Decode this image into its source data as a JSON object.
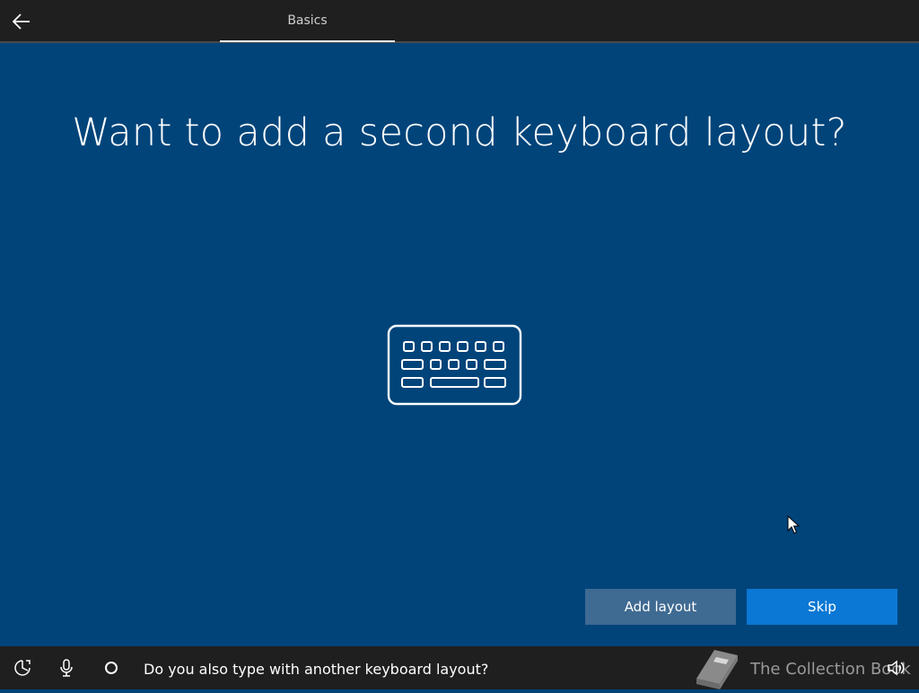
{
  "header": {
    "back_icon": "arrow-left-icon",
    "tab_label": "Basics"
  },
  "main": {
    "title": "Want to add a second keyboard layout?",
    "illustration_icon": "keyboard-icon"
  },
  "actions": {
    "add_layout_label": "Add layout",
    "skip_label": "Skip"
  },
  "footer": {
    "icons": [
      "accessibility-icon",
      "microphone-icon",
      "cortana-icon",
      "volume-icon"
    ],
    "caption": "Do you also type with another keyboard layout?",
    "watermark_text": "The Collection Book"
  },
  "colors": {
    "background": "#00447a",
    "bar": "#1f1f1f",
    "primary_button": "#0a78d4",
    "secondary_button": "#3f6a92"
  }
}
